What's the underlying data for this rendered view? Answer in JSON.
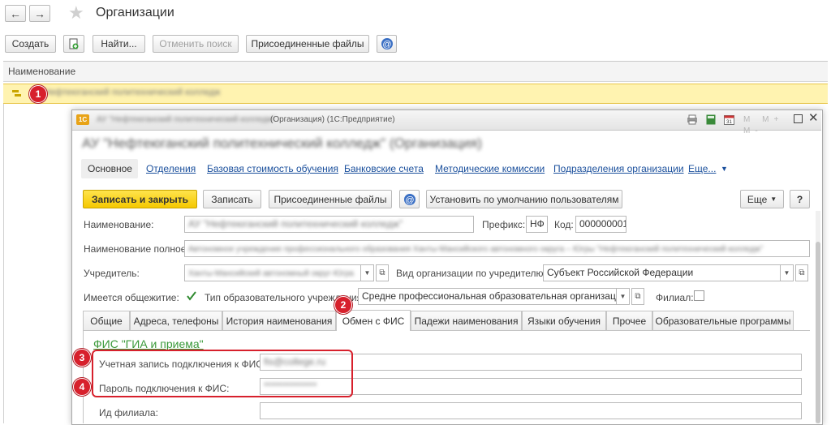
{
  "window": {
    "title": "Организации"
  },
  "toolbar": {
    "create": "Создать",
    "find": "Найти...",
    "cancel_search": "Отменить поиск",
    "attached_files": "Присоединенные файлы"
  },
  "list": {
    "column_header": "Наименование",
    "row_text": "Нефтеюганский политехнический колледж"
  },
  "form": {
    "titlebar": "АУ \"Нефтеюганский политехнический колледж\" (Организация) (1С:Предприятие)",
    "titlebar_visible": "(Организация) (1С:Предприятие)",
    "heading": "АУ \"Нефтеюганский политехнический колледж\" (Организация)",
    "nav": {
      "main": "Основное",
      "departments": "Отделения",
      "base_cost": "Базовая стоимость обучения",
      "bank_accounts": "Банковские счета",
      "methodic": "Методические комиссии",
      "subdivisions": "Подразделения организации",
      "more": "Еще..."
    },
    "cmd": {
      "save_close": "Записать и закрыть",
      "save": "Записать",
      "attached_files": "Присоединенные файлы",
      "set_default": "Установить по умолчанию пользователям",
      "more": "Еще",
      "help": "?"
    },
    "fields": {
      "name_label": "Наименование:",
      "name_value": "АУ \"Нефтеюганский политехнический колледж\"",
      "prefix_label": "Префикс:",
      "prefix_value": "НФ",
      "code_label": "Код:",
      "code_value": "000000001",
      "fullname_label": "Наименование полное:",
      "fullname_value": "Автономное учреждение профессионального образования Ханты-Мансийского автономного округа – Югры \"Нефтеюганский политехнический колледж\"",
      "founder_label": "Учредитель:",
      "founder_value": "Ханты-Мансийский автономный округ-Югра",
      "orgtype_label": "Вид организации по учредителю:",
      "orgtype_value": "Субъект Российской Федерации",
      "dorm_label": "Имеется общежитие:",
      "edutype_label": "Тип образовательного учреждения:",
      "edutype_value": "Средне профессиональная образовательная организация",
      "branch_label": "Филиал:"
    },
    "tabs": [
      "Общие",
      "Адреса, телефоны",
      "История наименования",
      "Обмен с ФИС",
      "Падежи наименования",
      "Языки обучения",
      "Прочее",
      "Образовательные программы"
    ],
    "fis": {
      "section": "ФИС \"ГИА и приема\"",
      "account_label": "Учетная запись подключения к ФИС:",
      "account_value": "fis@college.ru",
      "password_label": "Пароль подключения к ФИС:",
      "password_value": "**************",
      "branch_id_label": "Ид филиала:"
    }
  },
  "markers": [
    "1",
    "2",
    "3",
    "4"
  ],
  "colors": {
    "highlight_row": "#fff3b0",
    "marker": "#d7202c",
    "save_close_button": "#f5c800",
    "link": "#1a4f9c",
    "section_title": "#3a9a3a"
  },
  "icons": [
    "back-arrow-icon",
    "forward-arrow-icon",
    "star-icon",
    "add-copy-icon",
    "at-icon",
    "tree-node-icon",
    "checkmark-icon",
    "window-print-icon",
    "window-calc-icon",
    "window-calendar-icon",
    "window-close-icon"
  ]
}
